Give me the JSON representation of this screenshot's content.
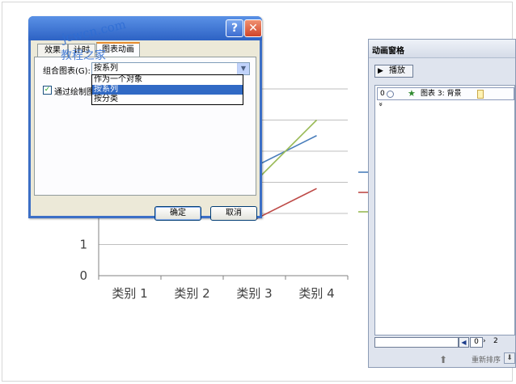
{
  "chart_data": {
    "type": "line",
    "categories": [
      "类别 1",
      "类别 2",
      "类别 3",
      "类别 4"
    ],
    "ytick_labels": [
      "0",
      "1"
    ],
    "series": [
      {
        "color": "#4a7ebb",
        "values": [
          4.3,
          2.5,
          3.5,
          4.5
        ]
      },
      {
        "color": "#be4b48",
        "values": [
          2.4,
          4.4,
          1.8,
          2.8
        ]
      },
      {
        "color": "#98b954",
        "values": [
          2.0,
          2.0,
          3.0,
          5.0
        ]
      }
    ]
  },
  "dialog": {
    "watermark_line1": "jcwcn.com",
    "watermark_line2": "教程之家",
    "help_label": "?",
    "close_label": "✕",
    "tabs": [
      "效果",
      "计时",
      "图表动画"
    ],
    "group_chart_label": "组合图表(G):",
    "group_chart_value": "按系列",
    "checkbox_label": "通过绘制图",
    "options": [
      "作为一个对象",
      "按系列",
      "按分类"
    ],
    "ok_label": "确定",
    "cancel_label": "取消"
  },
  "pane": {
    "title": "动画窗格",
    "play_label": "播放",
    "item_number": "0",
    "item_name": "图表 3: 背景",
    "expand_glyph": "»",
    "timeline_zero": "0",
    "timeline_mid": "›",
    "timeline_two": "2",
    "reorder_label": "重新排序"
  },
  "colors": {
    "gridline": "#bfbfbf",
    "axis": "#808080",
    "dialog_titlebar": "#2d62c4",
    "selection": "#316ac5"
  }
}
